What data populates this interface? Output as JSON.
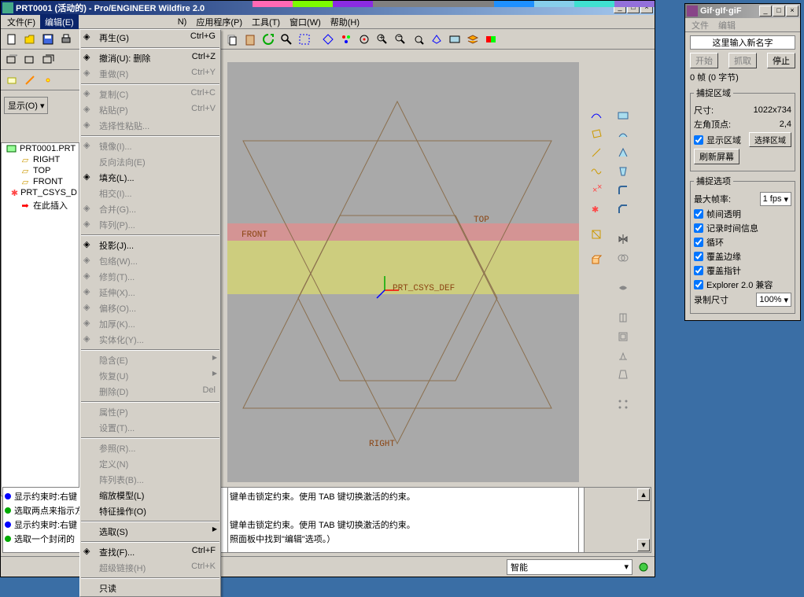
{
  "main": {
    "title": "PRT0001 (活动的) - Pro/ENGINEER Wildfire 2.0",
    "menubar": [
      "文件(F)",
      "编辑(E)",
      "",
      "",
      "",
      "N)",
      "应用程序(P)",
      "工具(T)",
      "窗口(W)",
      "帮助(H)"
    ],
    "display_label": "显示(O) ▾",
    "tree": {
      "root": "PRT0001.PRT",
      "items": [
        "RIGHT",
        "TOP",
        "FRONT",
        "PRT_CSYS_D",
        "在此插入"
      ]
    },
    "canvas_labels": {
      "top": "TOP",
      "front": "FRONT",
      "right": "RIGHT",
      "csys": "PRT_CSYS_DEF"
    },
    "messages": [
      {
        "color": "blue",
        "text": "显示约束时:右键"
      },
      {
        "color": "green",
        "text": "选取两点来指示方"
      },
      {
        "color": "blue",
        "text": "显示约束时:右键"
      },
      {
        "color": "green",
        "text": "选取一个封闭的"
      }
    ],
    "message_right": [
      "键单击锁定约束。使用 TAB 键切换激活的约束。",
      "",
      "键单击锁定约束。使用 TAB 键切换激活的约束。",
      "照面板中找到\"编辑\"选项。）"
    ],
    "status_select": "智能"
  },
  "edit_menu": [
    {
      "label": "再生(G)",
      "shortcut": "Ctrl+G",
      "enabled": true,
      "icon": "regen"
    },
    {
      "sep": true
    },
    {
      "label": "撤消(U): 删除",
      "shortcut": "Ctrl+Z",
      "enabled": true,
      "icon": "undo"
    },
    {
      "label": "重做(R)",
      "shortcut": "Ctrl+Y",
      "enabled": false,
      "icon": "redo"
    },
    {
      "sep": true
    },
    {
      "label": "复制(C)",
      "shortcut": "Ctrl+C",
      "enabled": false,
      "icon": "copy"
    },
    {
      "label": "粘贴(P)",
      "shortcut": "Ctrl+V",
      "enabled": false,
      "icon": "paste"
    },
    {
      "label": "选择性粘贴...",
      "enabled": false,
      "icon": "pspecial"
    },
    {
      "sep": true
    },
    {
      "label": "镜像(I)...",
      "enabled": false,
      "icon": "mirror"
    },
    {
      "label": "反向法向(E)",
      "enabled": false
    },
    {
      "label": "填充(L)...",
      "enabled": true,
      "icon": "fill"
    },
    {
      "label": "相交(I)...",
      "enabled": false
    },
    {
      "label": "合并(G)...",
      "enabled": false,
      "icon": "merge"
    },
    {
      "label": "阵列(P)...",
      "enabled": false,
      "icon": "pattern"
    },
    {
      "sep": true
    },
    {
      "label": "投影(J)...",
      "enabled": true,
      "icon": "project"
    },
    {
      "label": "包络(W)...",
      "enabled": false,
      "icon": "wrap"
    },
    {
      "label": "修剪(T)...",
      "enabled": false,
      "icon": "trim"
    },
    {
      "label": "延伸(X)...",
      "enabled": false,
      "icon": "extend"
    },
    {
      "label": "偏移(O)...",
      "enabled": false,
      "icon": "offset"
    },
    {
      "label": "加厚(K)...",
      "enabled": false,
      "icon": "thicken"
    },
    {
      "label": "实体化(Y)...",
      "enabled": false,
      "icon": "solid"
    },
    {
      "sep": true
    },
    {
      "label": "隐含(E)",
      "enabled": false,
      "arrow": true
    },
    {
      "label": "恢复(U)",
      "enabled": false,
      "arrow": true
    },
    {
      "label": "删除(D)",
      "shortcut": "Del",
      "enabled": false
    },
    {
      "sep": true
    },
    {
      "label": "属性(P)",
      "enabled": false
    },
    {
      "label": "设置(T)...",
      "enabled": false
    },
    {
      "sep": true
    },
    {
      "label": "参照(R)...",
      "enabled": false
    },
    {
      "label": "定义(N)",
      "enabled": false
    },
    {
      "label": "阵列表(B)...",
      "enabled": false
    },
    {
      "label": "缩放模型(L)",
      "enabled": true
    },
    {
      "label": "特征操作(O)",
      "enabled": true
    },
    {
      "sep": true
    },
    {
      "label": "选取(S)",
      "enabled": true,
      "arrow": true
    },
    {
      "sep": true
    },
    {
      "label": "查找(F)...",
      "shortcut": "Ctrl+F",
      "enabled": true,
      "icon": "find"
    },
    {
      "label": "超级链接(H)",
      "shortcut": "Ctrl+K",
      "enabled": false
    },
    {
      "sep": true
    },
    {
      "label": "只读",
      "enabled": true
    }
  ],
  "gif": {
    "title": "Gif·gIf·giF",
    "menus": [
      "文件",
      "编辑"
    ],
    "name_label": "这里输入新名字",
    "btns": {
      "start": "开始",
      "grab": "抓取",
      "stop": "停止"
    },
    "frames": "0 帧 (0 字节)",
    "capture_legend": "捕捉区域",
    "size_label": "尺寸:",
    "size_value": "1022x734",
    "corner_label": "左角顶点:",
    "corner_value": "2,4",
    "show_area": "显示区域",
    "select_area": "选择区域",
    "refresh": "刷新屏幕",
    "options_legend": "捕捉选项",
    "maxrate_label": "最大帧率:",
    "maxrate_value": "1 fps",
    "opts": [
      "帧间透明",
      "记录时间信息",
      "循环",
      "覆盖边缘",
      "覆盖指针",
      "Explorer 2.0 兼容"
    ],
    "recsize_label": "录制尺寸",
    "recsize_value": "100%"
  },
  "color_tabs": [
    "#ff69b4",
    "#7cfc00",
    "#8a2be2",
    "#808080",
    "#808080",
    "#808080",
    "#1e90ff",
    "#87ceeb",
    "#40e0d0",
    "#9370db"
  ]
}
